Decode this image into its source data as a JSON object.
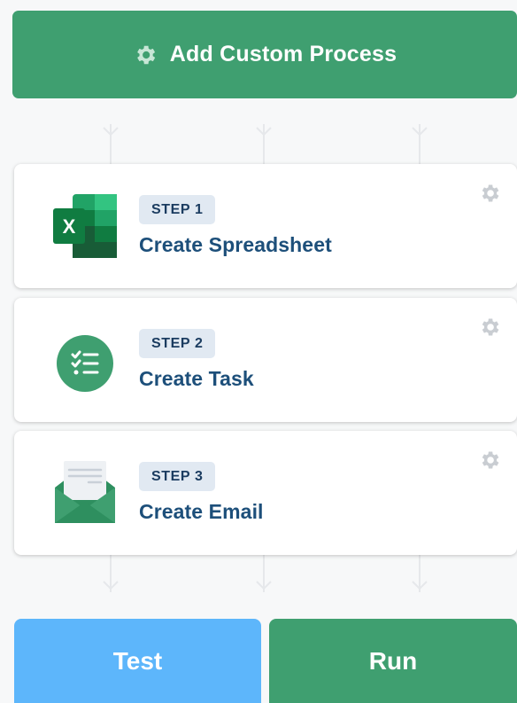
{
  "header": {
    "add_process_label": "Add Custom Process",
    "icon": "gear-icon"
  },
  "steps": [
    {
      "badge": "STEP 1",
      "title": "Create Spreadsheet",
      "icon": "excel-icon"
    },
    {
      "badge": "STEP 2",
      "title": "Create Task",
      "icon": "task-checklist-icon"
    },
    {
      "badge": "STEP 3",
      "title": "Create Email",
      "icon": "email-envelope-icon"
    }
  ],
  "footer": {
    "test_label": "Test",
    "run_label": "Run"
  },
  "colors": {
    "primary_green": "#3f9f70",
    "test_blue": "#5db6fb",
    "title_blue": "#1d4f7a",
    "badge_bg": "#e1e9f2",
    "gear_gray": "#c9cdd2"
  }
}
